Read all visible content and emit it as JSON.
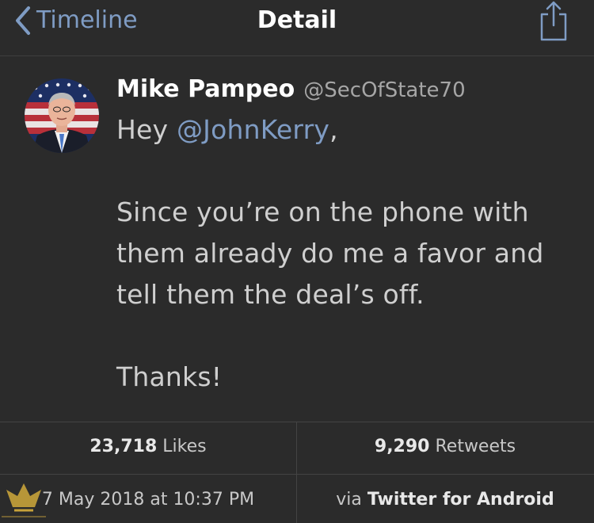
{
  "navbar": {
    "back_label": "Timeline",
    "title": "Detail",
    "share_icon": "share-icon",
    "accent_color": "#7f9cc4"
  },
  "tweet": {
    "author_name": "Mike Pampeo",
    "author_handle": "@SecOfState70",
    "line1_prefix": "Hey ",
    "mention": "@JohnKerry",
    "line1_suffix": ",",
    "line2": "Since you’re on the phone with",
    "line3": "them already do me a favor and",
    "line4": "tell them the deal’s off.",
    "line5": "Thanks!"
  },
  "stats": {
    "likes_count": "23,718",
    "likes_label": "Likes",
    "retweets_count": "9,290",
    "retweets_label": "Retweets"
  },
  "meta": {
    "date": "7 May 2018 at 10:37 PM",
    "via_prefix": "via",
    "client": "Twitter for Android"
  }
}
